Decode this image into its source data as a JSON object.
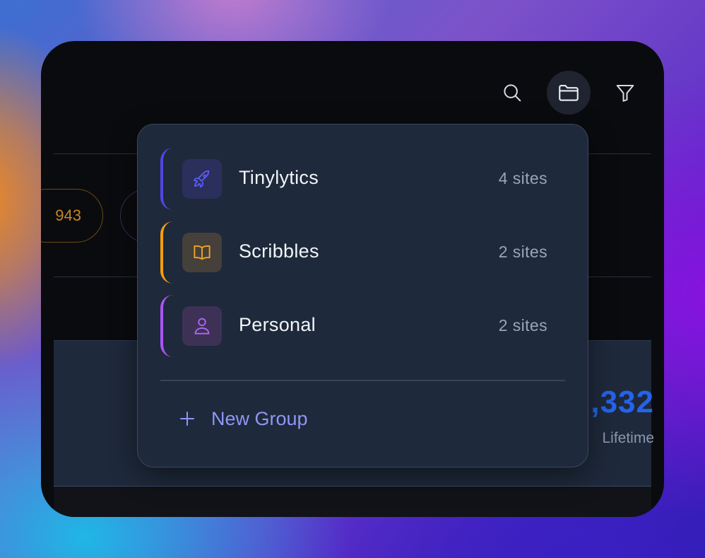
{
  "toolbar": {
    "search_icon": "search-icon",
    "folder_icon": "folder-icon",
    "filter_icon": "filter-icon"
  },
  "background": {
    "pill_value": "943",
    "stat_value": ",332",
    "stat_label": "Lifetime"
  },
  "dropdown": {
    "groups": [
      {
        "name": "Tinylytics",
        "count": "4 sites",
        "icon": "rocket-icon",
        "accent": "#4f46e5",
        "icon_bg": "#2a2f5c",
        "icon_color": "#5b5bf0"
      },
      {
        "name": "Scribbles",
        "count": "2 sites",
        "icon": "book-open-icon",
        "accent": "#f59e0b",
        "icon_bg": "#45403a",
        "icon_color": "#f5a524"
      },
      {
        "name": "Personal",
        "count": "2 sites",
        "icon": "user-icon",
        "accent": "#a855f7",
        "icon_bg": "#3d3256",
        "icon_color": "#b265f5"
      }
    ],
    "new_group_label": "New Group"
  }
}
